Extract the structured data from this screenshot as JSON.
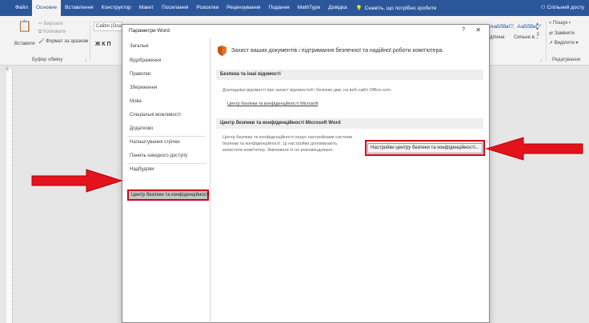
{
  "ribbon_tabs": [
    "Файл",
    "Основне",
    "Вставлення",
    "Конструктор",
    "Макет",
    "Посилання",
    "Розсилки",
    "Рецензування",
    "Подання",
    "MathType",
    "Довідка"
  ],
  "ribbon_hint": "Скажіть, що потрібно зробити",
  "share_label": "Спільний досту",
  "ribbon": {
    "paste_label": "Вставити",
    "cut_label": "Вирізати",
    "copy_label": "Копіювати",
    "format_painter_label": "Формат за зразком",
    "clipboard_group": "Буфер обміну",
    "font_box": "Calibri (Осно",
    "font_tools": "Ж К П",
    "styles_sample1": "АаБбВвГґ,",
    "styles_sample2": "АаБбВвГґ",
    "style_name1": "ділена",
    "style_name2": "Сильне в...",
    "search_label": "Пошук",
    "replace_label": "Замінити",
    "select_label": "Виділити",
    "edit_group": "Редагування"
  },
  "dialog": {
    "title": "Параметри Word",
    "help": "?",
    "close": "✕",
    "nav_items": [
      "Загальні",
      "Відображення",
      "Правопис",
      "Збереження",
      "Мова",
      "Спеціальні можливості",
      "Додатково",
      "Налаштування стрічки",
      "Панель швидкого доступу",
      "Надбудови"
    ],
    "nav_selected": "Центр безпеки та конфіденційності",
    "header_text": "Захист ваших документів і підтримання безпечної та надійної роботи комп'ютера.",
    "section1_title": "Безпека та інші відомості",
    "section1_text": "Докладніші відомості про захист відомостей і безпеки див. на веб-сайті Office.com.",
    "section1_link": "Центр безпеки та конфіденційності Microsoft",
    "section2_title": "Центр безпеки та конфіденційності Microsoft Word",
    "section2_text_lines": [
      "Центр безпеки та конфіденційності керує настройками системи",
      "безпеки та конфіденційності. Ці настройки допомагають",
      "захистити комп'ютер. Змінювати їх не рекомендовано."
    ],
    "trust_center_button": "Настройки центру безпеки та конфіденційності..."
  },
  "colors": {
    "ribbon_blue": "#2b579a",
    "highlight_red": "#d0021b",
    "shield_orange": "#e8711c"
  }
}
